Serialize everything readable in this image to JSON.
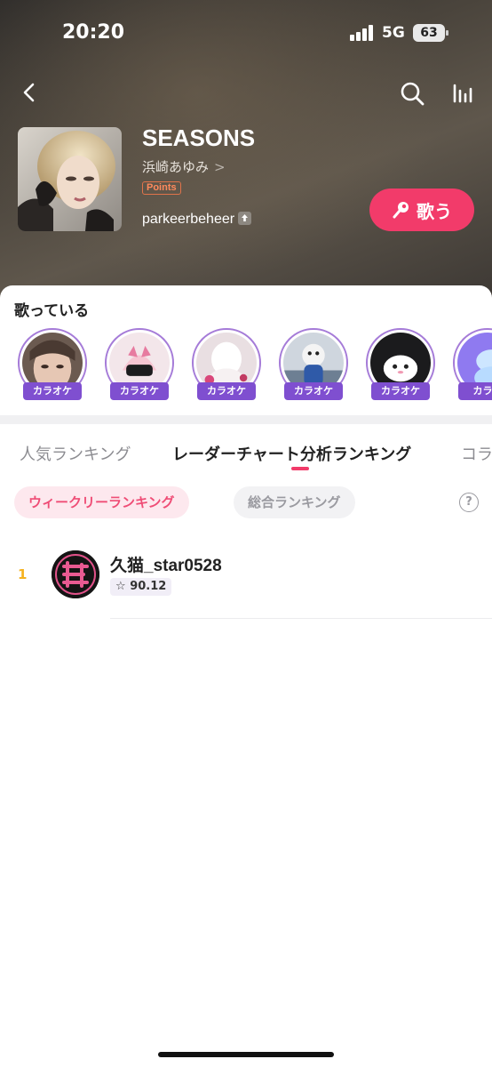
{
  "status": {
    "time": "20:20",
    "network": "5G",
    "battery": "63"
  },
  "nav": {
    "back_icon": "back-chevron-icon",
    "search_icon": "search-icon",
    "equalizer_icon": "equalizer-icon"
  },
  "song": {
    "title": "SEASONS",
    "artist": "浜崎あゆみ",
    "artist_chevron": ">",
    "badge": "Points",
    "uploader": "parkeerbeheer",
    "sing_label": "歌う"
  },
  "singing": {
    "title": "歌っている",
    "tag": "カラオケ",
    "singers": [
      {
        "tag": "カラオケ"
      },
      {
        "tag": "カラオケ"
      },
      {
        "tag": "カラオケ"
      },
      {
        "tag": "カラオケ"
      },
      {
        "tag": "カラオケ"
      },
      {
        "tag": "カラオ"
      }
    ]
  },
  "tabs": [
    {
      "label": "人気ランキング",
      "active": false
    },
    {
      "label": "レーダーチャート分析ランキング",
      "active": true
    },
    {
      "label": "コラ",
      "active": false
    }
  ],
  "filters": {
    "weekly": "ウィークリーランキング",
    "total": "総合ランキング",
    "help": "?"
  },
  "ranking": [
    {
      "rank": "1",
      "name": "久猫_star0528",
      "score_icon": "☆",
      "score": "90.12"
    }
  ],
  "colors": {
    "accent": "#f23b6a",
    "badge_purple": "#7f4fd0",
    "rank_gold": "#f5b21f"
  }
}
